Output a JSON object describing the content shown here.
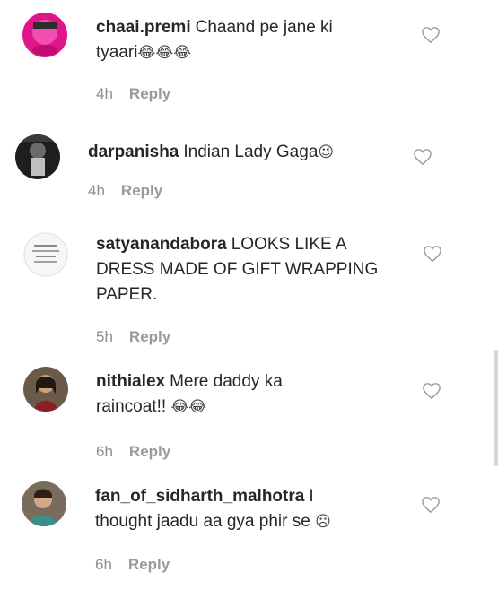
{
  "comments": [
    {
      "username": "chaai.premi",
      "text": "Chaand pe jane ki tyaari",
      "emojis": "😂😂😂",
      "time": "4h",
      "reply": "Reply",
      "avatar": "avatar-pink-photo"
    },
    {
      "username": "darpanisha",
      "text": "Indian Lady Gaga",
      "emojis": "😉",
      "time": "4h",
      "reply": "Reply",
      "avatar": "avatar-dark-photo"
    },
    {
      "username": "satyanandabora",
      "text": "LOOKS LIKE A DRESS MADE OF GIFT WRAPPING PAPER.",
      "emojis": "",
      "time": "5h",
      "reply": "Reply",
      "avatar": "avatar-text-logo"
    },
    {
      "username": "nithialex",
      "text": "Mere daddy ka raincoat!!",
      "emojis": "😂😂",
      "time": "6h",
      "reply": "Reply",
      "avatar": "avatar-woman-photo"
    },
    {
      "username": "fan_of_sidharth_malhotra",
      "text": "I thought jaadu aa gya phir se",
      "emojis": "☹",
      "time": "6h",
      "reply": "Reply",
      "avatar": "avatar-man-photo"
    }
  ],
  "icons": {
    "like": "heart-outline-icon"
  },
  "colors": {
    "text": "#262626",
    "muted": "#8e8e8e"
  }
}
